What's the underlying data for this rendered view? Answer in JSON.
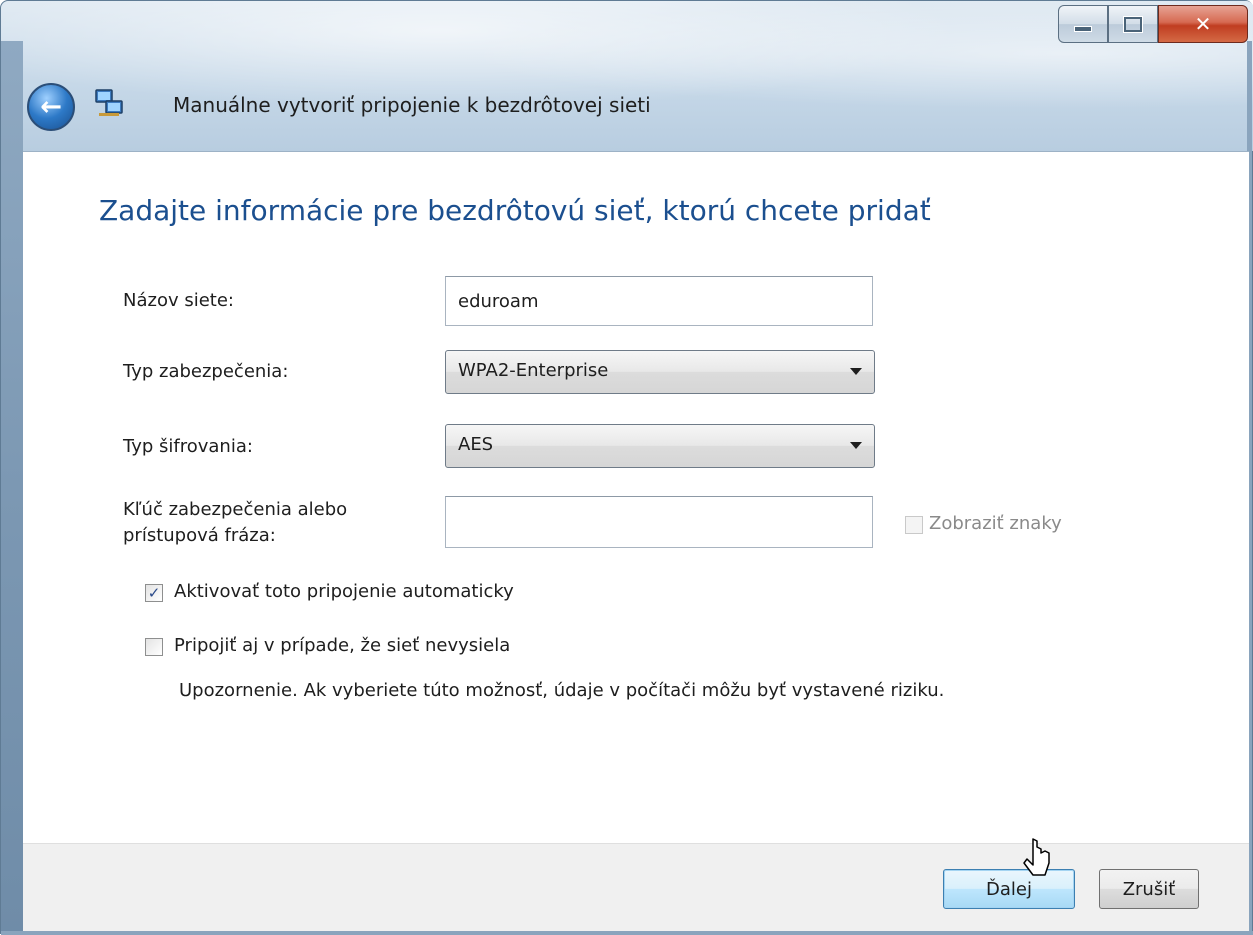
{
  "window": {
    "title": "Manuálne vytvoriť pripojenie k bezdrôtovej sieti",
    "controls": {
      "minimize": "minimize-icon",
      "maximize": "maximize-icon",
      "close": "close-icon"
    }
  },
  "content": {
    "heading": "Zadajte informácie pre bezdrôtovú sieť, ktorú chcete pridať",
    "network_name": {
      "label": "Názov siete:",
      "value": "eduroam"
    },
    "security_type": {
      "label": "Typ zabezpečenia:",
      "value": "WPA2-Enterprise"
    },
    "encryption_type": {
      "label": "Typ šifrovania:",
      "value": "AES"
    },
    "security_key": {
      "label_line1": "Kľúč zabezpečenia alebo",
      "label_line2": "prístupová fráza:",
      "value": "",
      "show_chars_label": "Zobraziť znaky",
      "show_chars_checked": false
    },
    "auto_connect": {
      "label": "Aktivovať toto pripojenie automaticky",
      "checked": true
    },
    "connect_hidden": {
      "label": "Pripojiť aj v prípade, že sieť nevysiela",
      "checked": false
    },
    "warning": "Upozornenie. Ak vyberiete túto možnosť, údaje v počítači môžu byť vystavené riziku."
  },
  "footer": {
    "next_label": "Ďalej",
    "cancel_label": "Zrušiť"
  },
  "colors": {
    "heading": "#1b4f8f",
    "primary_button": "#bee6fd",
    "close_button": "#c03d21"
  }
}
